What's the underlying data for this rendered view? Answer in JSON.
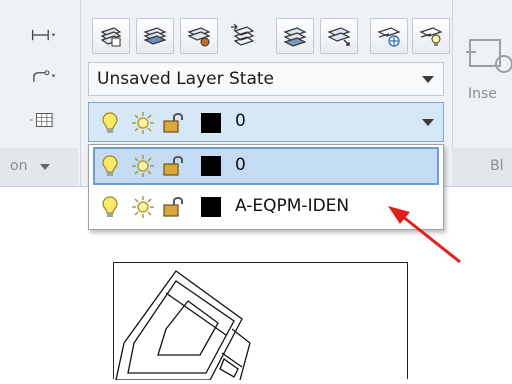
{
  "layer_state_combo": {
    "value": "Unsaved Layer State"
  },
  "current_layer": {
    "name": "0",
    "color": "#000000"
  },
  "layer_dropdown": {
    "items": [
      {
        "name": "0",
        "color": "#000000",
        "selected": true
      },
      {
        "name": "A-EQPM-IDEN",
        "color": "#000000",
        "selected": false
      }
    ]
  },
  "panels": {
    "left_label": "on",
    "right_label_1": "Inse",
    "right_label_2": "Bl"
  },
  "colors": {
    "ribbon_bg": "#eef1f5",
    "selected_bg": "#c4dcf3",
    "selected_border": "#6d9ccd",
    "callout_arrow": "#e0201b"
  }
}
